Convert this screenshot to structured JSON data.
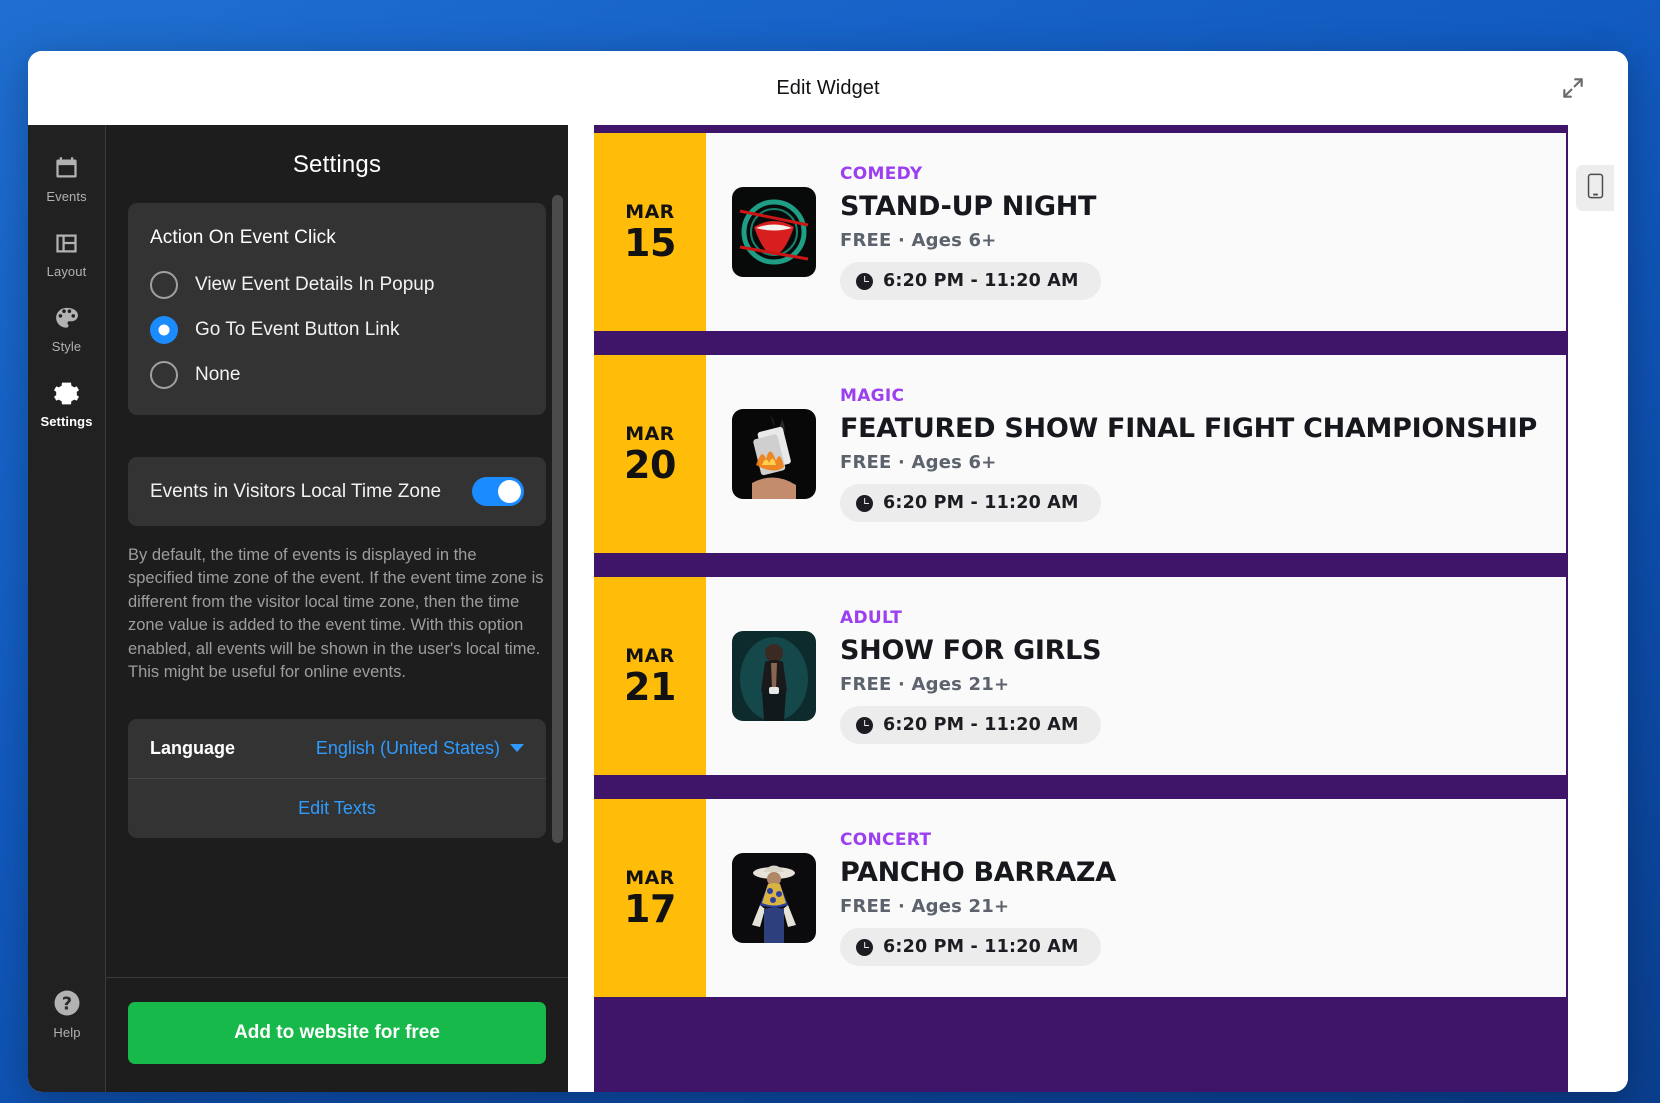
{
  "window": {
    "title": "Edit Widget",
    "expand_icon": "expand-arrows-icon"
  },
  "rail": {
    "items": [
      {
        "label": "Events",
        "icon": "calendar-icon"
      },
      {
        "label": "Layout",
        "icon": "layout-icon"
      },
      {
        "label": "Style",
        "icon": "palette-icon"
      },
      {
        "label": "Settings",
        "icon": "gear-icon"
      }
    ],
    "help": {
      "label": "Help",
      "icon": "question-circle-icon"
    }
  },
  "settings": {
    "title": "Settings",
    "action_on_event_click": {
      "heading": "Action On Event Click",
      "options": [
        {
          "label": "View Event Details In Popup",
          "selected": false
        },
        {
          "label": "Go To Event Button Link",
          "selected": true
        },
        {
          "label": "None",
          "selected": false
        }
      ]
    },
    "timezone": {
      "label": "Events in Visitors Local Time Zone",
      "enabled": true,
      "description": "By default, the time of events is displayed in the specified time zone of the event. If the event time zone is different from the visitor local time zone, then the time zone value is added to the event time. With this option enabled, all events will be shown in the user's local time. This might be useful for online events."
    },
    "language": {
      "label": "Language",
      "value": "English (United States)",
      "caret_icon": "chevron-down-icon"
    },
    "edit_texts": "Edit Texts",
    "cta": "Add to website for free"
  },
  "preview": {
    "device_toggle_icon": "mobile-phone-icon",
    "colors": {
      "page_background": "#1763c8",
      "preview_background": "#3e1568",
      "date_column": "#ffbd0a",
      "category_text": "#9b3ff0",
      "accent_blue": "#1a8cff",
      "cta_green": "#17b94a"
    },
    "events": [
      {
        "month": "MAR",
        "day": "15",
        "category": "COMEDY",
        "title": "STAND-UP NIGHT",
        "meta": "FREE  ·  Ages 6+",
        "time": "6:20 PM - 11:20 AM",
        "thumb": "comedy-mouth-poster"
      },
      {
        "month": "MAR",
        "day": "20",
        "category": "MAGIC",
        "title": "FEATURED SHOW FINAL FIGHT CHAMPIONSHIP",
        "meta": "FREE  ·  Ages 6+",
        "time": "6:20 PM - 11:20 AM",
        "thumb": "burning-cards-photo"
      },
      {
        "month": "MAR",
        "day": "21",
        "category": "ADULT",
        "title": "SHOW FOR GIRLS",
        "meta": "FREE  ·  Ages 21+",
        "time": "6:20 PM - 11:20 AM",
        "thumb": "male-dancer-photo"
      },
      {
        "month": "MAR",
        "day": "17",
        "category": "CONCERT",
        "title": "PANCHO BARRAZA",
        "meta": "FREE  ·  Ages 21+",
        "time": "6:20 PM - 11:20 AM",
        "thumb": "singer-cowboy-photo"
      }
    ]
  }
}
